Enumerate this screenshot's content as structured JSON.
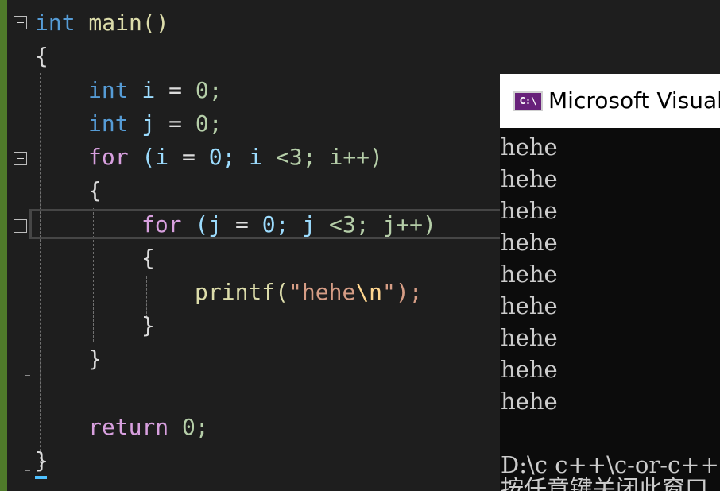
{
  "editor": {
    "lines": [
      {
        "parts": [
          "int",
          " main()"
        ]
      },
      {
        "parts": [
          "{"
        ]
      },
      {
        "parts": [
          "int",
          " i ",
          "=",
          " 0;"
        ]
      },
      {
        "parts": [
          "int",
          " j ",
          "=",
          " 0;"
        ]
      },
      {
        "parts": [
          "for",
          " (i ",
          "=",
          " 0; i ",
          "<3; i++)"
        ]
      },
      {
        "parts": [
          "{"
        ]
      },
      {
        "parts": [
          "for",
          " (j ",
          "=",
          " 0; j ",
          "<3; j++)"
        ]
      },
      {
        "parts": [
          "{"
        ]
      },
      {
        "parts": [
          "printf(",
          "\"hehe",
          "\\n",
          "\");"
        ]
      },
      {
        "parts": [
          "}"
        ]
      },
      {
        "parts": [
          "}"
        ]
      },
      {
        "parts": [
          "return",
          " 0;"
        ]
      },
      {
        "parts": [
          "}"
        ]
      }
    ]
  },
  "console": {
    "title": "Microsoft Visual Studio 调试控制台",
    "icon_text": "C:\\",
    "output": [
      "hehe",
      "hehe",
      "hehe",
      "hehe",
      "hehe",
      "hehe",
      "hehe",
      "hehe",
      "hehe"
    ],
    "path_line": "D:\\c c++\\c-or-c++",
    "prompt_line": "按任意键关闭此窗口. . ."
  },
  "icons": {
    "fold": "collapse-minus-icon",
    "console": "console-app-icon"
  },
  "colors": {
    "keyword": "#569cd6",
    "control": "#d8a0df",
    "function": "#dcdcaa",
    "string": "#d69d85",
    "number": "#b5cea8",
    "console_bg": "#0c0c0c",
    "editor_bg": "#1e1e1e"
  }
}
